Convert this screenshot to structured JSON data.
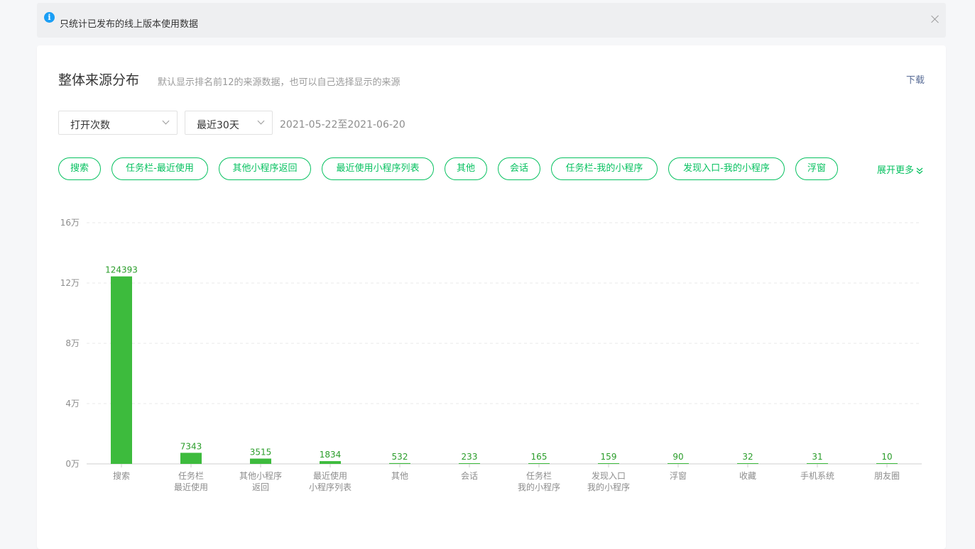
{
  "notice": {
    "text": "只统计已发布的线上版本使用数据"
  },
  "header": {
    "title": "整体来源分布",
    "subtitle": "默认显示排名前12的来源数据，也可以自己选择显示的来源",
    "download": "下载"
  },
  "filters": {
    "metric": "打开次数",
    "period": "最近30天",
    "date_range": "2021-05-22至2021-06-20"
  },
  "tags": [
    "搜索",
    "任务栏-最近使用",
    "其他小程序返回",
    "最近使用小程序列表",
    "其他",
    "会话",
    "任务栏-我的小程序",
    "发现入口-我的小程序",
    "浮窗"
  ],
  "expand_more": "展开更多",
  "colors": {
    "accent": "#07c160",
    "bar": "#3dbb3d",
    "grid": "#e8e8e8"
  },
  "chart_data": {
    "type": "bar",
    "categories": [
      [
        "搜索"
      ],
      [
        "任务栏",
        "最近使用"
      ],
      [
        "其他小程序",
        "返回"
      ],
      [
        "最近使用",
        "小程序列表"
      ],
      [
        "其他"
      ],
      [
        "会话"
      ],
      [
        "任务栏",
        "我的小程序"
      ],
      [
        "发现入口",
        "我的小程序"
      ],
      [
        "浮窗"
      ],
      [
        "收藏"
      ],
      [
        "手机系统"
      ],
      [
        "朋友圈"
      ]
    ],
    "values": [
      124393,
      7343,
      3515,
      1834,
      532,
      233,
      165,
      159,
      90,
      32,
      31,
      10
    ],
    "y_ticks": [
      "0万",
      "4万",
      "8万",
      "12万",
      "16万"
    ],
    "ylim": [
      0,
      160000
    ],
    "grid": true
  }
}
